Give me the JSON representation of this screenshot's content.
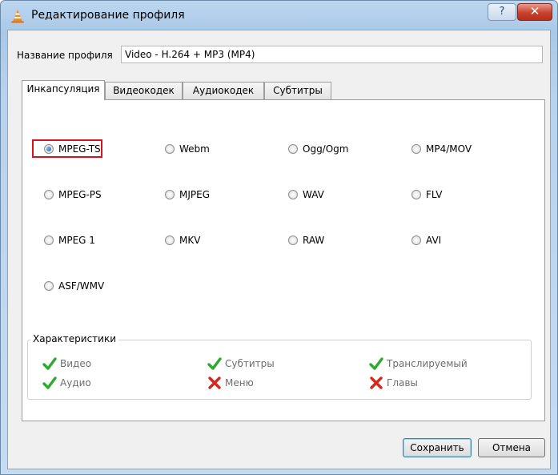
{
  "window": {
    "title": "Редактирование профиля",
    "help_label": "?",
    "close_label": "✕"
  },
  "profile": {
    "label": "Название профиля",
    "value": "Video - H.264 + MP3 (MP4)"
  },
  "tabs": [
    {
      "label": "Инкапсуляция",
      "active": true
    },
    {
      "label": "Видеокодек",
      "active": false
    },
    {
      "label": "Аудиокодек",
      "active": false
    },
    {
      "label": "Субтитры",
      "active": false
    }
  ],
  "formats": [
    {
      "label": "MPEG-TS",
      "checked": true
    },
    {
      "label": "Webm",
      "checked": false
    },
    {
      "label": "Ogg/Ogm",
      "checked": false
    },
    {
      "label": "MP4/MOV",
      "checked": false
    },
    {
      "label": "MPEG-PS",
      "checked": false
    },
    {
      "label": "MJPEG",
      "checked": false
    },
    {
      "label": "WAV",
      "checked": false
    },
    {
      "label": "FLV",
      "checked": false
    },
    {
      "label": "MPEG 1",
      "checked": false
    },
    {
      "label": "MKV",
      "checked": false
    },
    {
      "label": "RAW",
      "checked": false
    },
    {
      "label": "AVI",
      "checked": false
    },
    {
      "label": "ASF/WMV",
      "checked": false
    }
  ],
  "characteristics": {
    "title": "Характеристики",
    "items": [
      {
        "label": "Видео",
        "supported": true,
        "icon": "check-icon"
      },
      {
        "label": "Субтитры",
        "supported": true,
        "icon": "check-icon"
      },
      {
        "label": "Транслируемый",
        "supported": true,
        "icon": "check-icon"
      },
      {
        "label": "Аудио",
        "supported": true,
        "icon": "check-icon"
      },
      {
        "label": "Меню",
        "supported": false,
        "icon": "cross-icon"
      },
      {
        "label": "Главы",
        "supported": false,
        "icon": "cross-icon"
      }
    ]
  },
  "buttons": {
    "save": "Сохранить",
    "cancel": "Отмена"
  },
  "colors": {
    "highlight": "#d6121f",
    "check": "#2fa82f",
    "cross": "#d8261c"
  }
}
